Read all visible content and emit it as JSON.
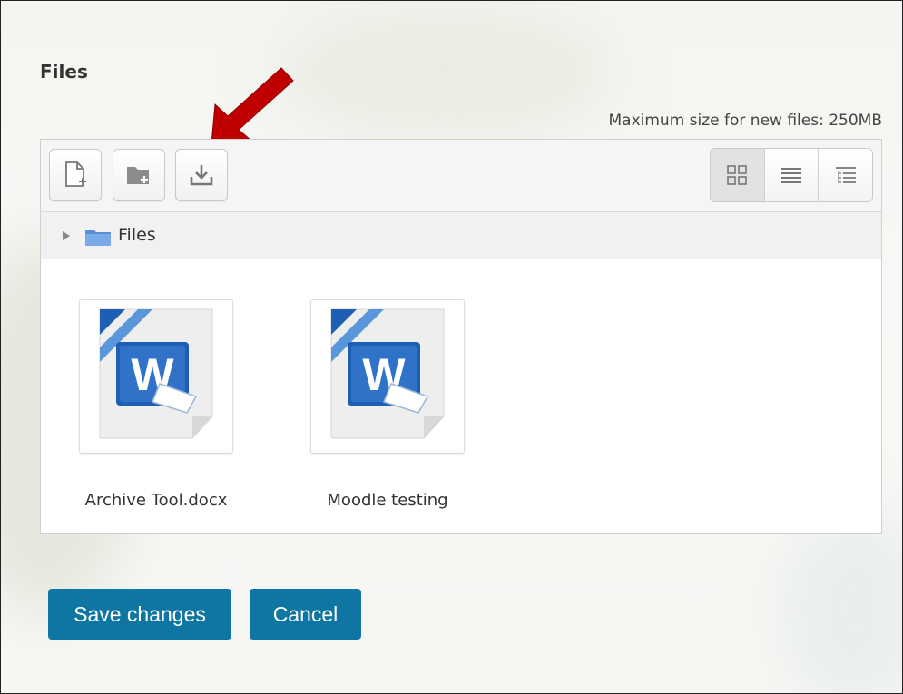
{
  "section": {
    "title": "Files"
  },
  "filemanager": {
    "max_size_text": "Maximum size for new files: 250MB",
    "toolbar": {
      "add_file_icon": "add-file-icon",
      "create_folder_icon": "create-folder-icon",
      "download_icon": "download-icon",
      "views": [
        "icons-view-icon",
        "list-view-icon",
        "tree-view-icon"
      ],
      "active_view": "icons-view-icon"
    },
    "path": {
      "label": "Files"
    },
    "files": [
      {
        "name": "Archive Tool.docx",
        "icon": "word-document-icon"
      },
      {
        "name": "Moodle testing",
        "icon": "word-document-icon"
      }
    ]
  },
  "actions": {
    "save_label": "Save changes",
    "cancel_label": "Cancel"
  },
  "colors": {
    "primary_button": "#0f76a3",
    "annotation_arrow": "#c00000",
    "word_blue": "#1f5fb3"
  }
}
